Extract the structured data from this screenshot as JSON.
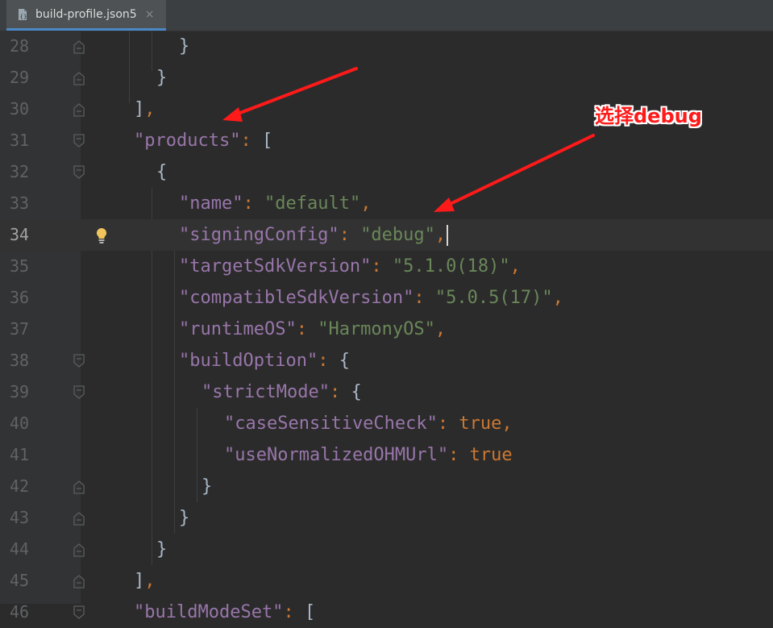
{
  "tab": {
    "filename": "build-profile.json5",
    "close_glyph": "×",
    "icon": "json5-file-icon"
  },
  "annotation": {
    "text": "选择debug",
    "color": "#ff1a1a"
  },
  "lines": [
    {
      "num": "28",
      "fold": "close"
    },
    {
      "num": "29",
      "fold": "close"
    },
    {
      "num": "30",
      "fold": "close"
    },
    {
      "num": "31",
      "fold": "open"
    },
    {
      "num": "32",
      "fold": "open"
    },
    {
      "num": "33"
    },
    {
      "num": "34",
      "current": true
    },
    {
      "num": "35"
    },
    {
      "num": "36"
    },
    {
      "num": "37"
    },
    {
      "num": "38",
      "fold": "open"
    },
    {
      "num": "39",
      "fold": "open"
    },
    {
      "num": "40"
    },
    {
      "num": "41"
    },
    {
      "num": "42",
      "fold": "close"
    },
    {
      "num": "43",
      "fold": "close"
    },
    {
      "num": "44",
      "fold": "close"
    },
    {
      "num": "45",
      "fold": "close"
    },
    {
      "num": "46",
      "fold": "open"
    }
  ],
  "code": {
    "l28": {
      "brace": "}"
    },
    "l29": {
      "brace": "}"
    },
    "l30": {
      "bracket": "]",
      "comma": ","
    },
    "l31": {
      "key": "\"products\"",
      "colon": ":",
      "bracket": "["
    },
    "l32": {
      "brace": "{"
    },
    "l33": {
      "key": "\"name\"",
      "colon": ":",
      "value": "\"default\"",
      "comma": ","
    },
    "l34": {
      "key": "\"signingConfig\"",
      "colon": ":",
      "value": "\"debug\"",
      "comma": ","
    },
    "l35": {
      "key": "\"targetSdkVersion\"",
      "colon": ":",
      "value": "\"5.1.0(18)\"",
      "comma": ","
    },
    "l36": {
      "key": "\"compatibleSdkVersion\"",
      "colon": ":",
      "value": "\"5.0.5(17)\"",
      "comma": ","
    },
    "l37": {
      "key": "\"runtimeOS\"",
      "colon": ":",
      "value": "\"HarmonyOS\"",
      "comma": ","
    },
    "l38": {
      "key": "\"buildOption\"",
      "colon": ":",
      "brace": "{"
    },
    "l39": {
      "key": "\"strictMode\"",
      "colon": ":",
      "brace": "{"
    },
    "l40": {
      "key": "\"caseSensitiveCheck\"",
      "colon": ":",
      "value": "true",
      "comma": ","
    },
    "l41": {
      "key": "\"useNormalizedOHMUrl\"",
      "colon": ":",
      "value": "true"
    },
    "l42": {
      "brace": "}"
    },
    "l43": {
      "brace": "}"
    },
    "l44": {
      "brace": "}"
    },
    "l45": {
      "bracket": "]",
      "comma": ","
    },
    "l46": {
      "key": "\"buildModeSet\"",
      "colon": ":",
      "bracket": "["
    }
  }
}
